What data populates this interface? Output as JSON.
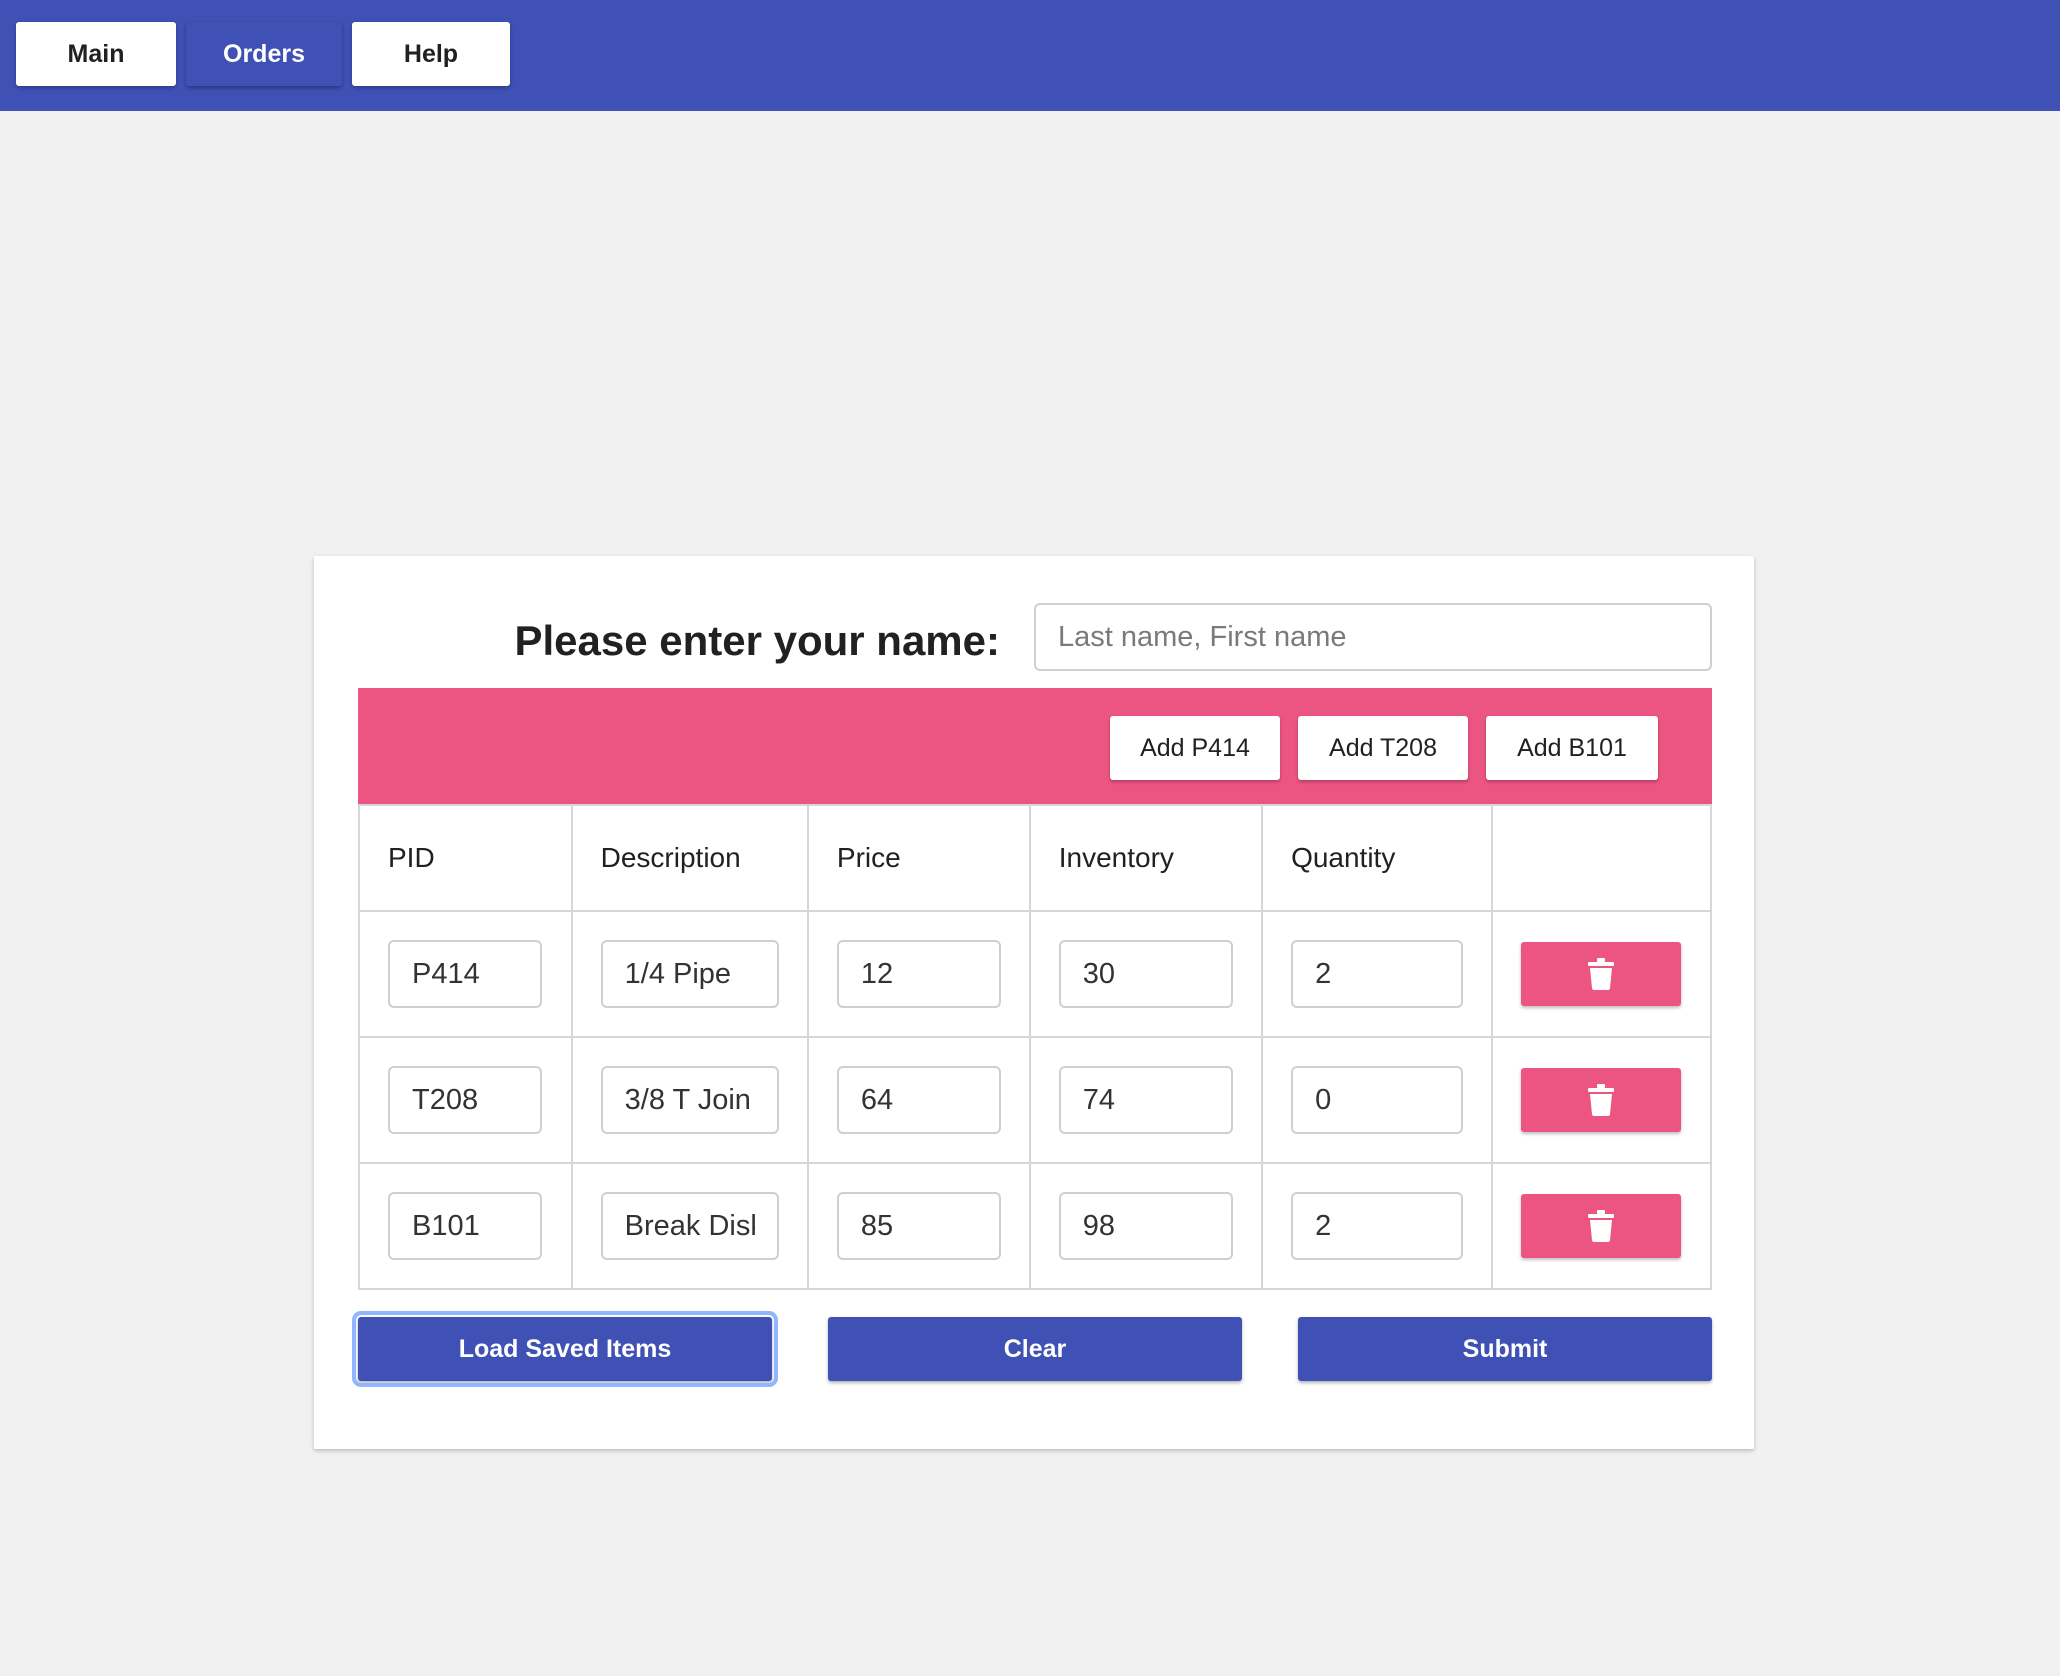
{
  "nav": {
    "items": [
      {
        "label": "Main",
        "active": false
      },
      {
        "label": "Orders",
        "active": true
      },
      {
        "label": "Help",
        "active": false
      }
    ]
  },
  "form": {
    "name_label": "Please enter your name:",
    "name_placeholder": "Last name, First name",
    "name_value": ""
  },
  "toolbar": {
    "add_buttons": [
      "Add P414",
      "Add T208",
      "Add B101"
    ]
  },
  "table": {
    "headers": [
      "PID",
      "Description",
      "Price",
      "Inventory",
      "Quantity",
      ""
    ],
    "rows": [
      {
        "pid": "P414",
        "description": "1/4 Pipe",
        "price": "12",
        "inventory": "30",
        "quantity": "2",
        "delete_icon": "trash-icon"
      },
      {
        "pid": "T208",
        "description": "3/8 T Join",
        "price": "64",
        "inventory": "74",
        "quantity": "0",
        "delete_icon": "trash-icon"
      },
      {
        "pid": "B101",
        "description": "Break Disk",
        "price": "85",
        "inventory": "98",
        "quantity": "2",
        "delete_icon": "trash-icon"
      }
    ]
  },
  "actions": {
    "load_label": "Load Saved Items",
    "clear_label": "Clear",
    "submit_label": "Submit"
  },
  "colors": {
    "primary": "#3f51b5",
    "accent": "#ec5482",
    "background": "#f1f1f1",
    "focus_ring": "#8fb6ff"
  }
}
